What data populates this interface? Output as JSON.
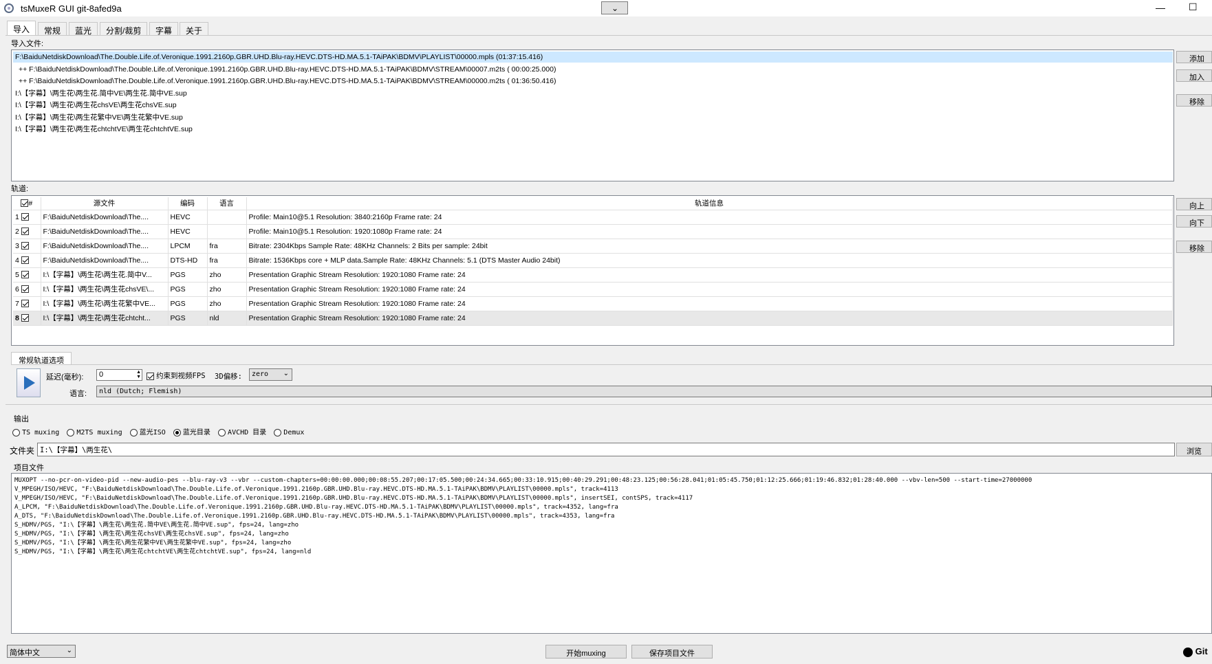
{
  "window": {
    "title": "tsMuxeR GUI git-8afed9a"
  },
  "tabs": [
    "导入",
    "常规",
    "蓝光",
    "分割/裁剪",
    "字幕",
    "关于"
  ],
  "input": {
    "label": "导入文件:",
    "files": [
      "F:\\BaiduNetdiskDownload\\The.Double.Life.of.Veronique.1991.2160p.GBR.UHD.Blu-ray.HEVC.DTS-HD.MA.5.1-TAiPAK\\BDMV\\PLAYLIST\\00000.mpls (01:37:15.416)",
      "++ F:\\BaiduNetdiskDownload\\The.Double.Life.of.Veronique.1991.2160p.GBR.UHD.Blu-ray.HEVC.DTS-HD.MA.5.1-TAiPAK\\BDMV\\STREAM\\00007.m2ts ( 00:00:25.000)",
      "++ F:\\BaiduNetdiskDownload\\The.Double.Life.of.Veronique.1991.2160p.GBR.UHD.Blu-ray.HEVC.DTS-HD.MA.5.1-TAiPAK\\BDMV\\STREAM\\00000.m2ts ( 01:36:50.416)",
      "I:\\【字幕】\\两生花\\两生花.简中VE\\两生花.简中VE.sup",
      "I:\\【字幕】\\两生花\\两生花chsVE\\两生花chsVE.sup",
      "I:\\【字幕】\\两生花\\两生花繁中VE\\两生花繁中VE.sup",
      "I:\\【字幕】\\两生花\\两生花chtchtVE\\两生花chtchtVE.sup"
    ],
    "buttons": {
      "add": "添加",
      "append": "加入",
      "remove": "移除"
    }
  },
  "tracks": {
    "label": "轨道:",
    "headers": [
      "#",
      "源文件",
      "编码",
      "语言",
      "轨道信息"
    ],
    "rows": [
      {
        "num": "1",
        "src": "F:\\BaiduNetdiskDownload\\The....",
        "codec": "HEVC",
        "lang": "",
        "info": "Profile: Main10@5.1 Resolution: 3840:2160p  Frame rate: 24"
      },
      {
        "num": "2",
        "src": "F:\\BaiduNetdiskDownload\\The....",
        "codec": "HEVC",
        "lang": "",
        "info": "Profile: Main10@5.1 Resolution: 1920:1080p  Frame rate: 24"
      },
      {
        "num": "3",
        "src": "F:\\BaiduNetdiskDownload\\The....",
        "codec": "LPCM",
        "lang": "fra",
        "info": "Bitrate: 2304Kbps  Sample Rate: 48KHz  Channels: 2  Bits per sample: 24bit"
      },
      {
        "num": "4",
        "src": "F:\\BaiduNetdiskDownload\\The....",
        "codec": "DTS-HD",
        "lang": "fra",
        "info": "Bitrate: 1536Kbps  core + MLP data.Sample Rate: 48KHz  Channels: 5.1 (DTS Master Audio 24bit)"
      },
      {
        "num": "5",
        "src": "I:\\【字幕】\\两生花\\两生花.简中V...",
        "codec": "PGS",
        "lang": "zho",
        "info": "Presentation Graphic Stream Resolution: 1920:1080 Frame rate: 24"
      },
      {
        "num": "6",
        "src": "I:\\【字幕】\\两生花\\两生花chsVE\\...",
        "codec": "PGS",
        "lang": "zho",
        "info": "Presentation Graphic Stream Resolution: 1920:1080 Frame rate: 24"
      },
      {
        "num": "7",
        "src": "I:\\【字幕】\\两生花\\两生花繁中VE...",
        "codec": "PGS",
        "lang": "zho",
        "info": "Presentation Graphic Stream Resolution: 1920:1080 Frame rate: 24"
      },
      {
        "num": "8",
        "src": "I:\\【字幕】\\两生花\\两生花chtcht...",
        "codec": "PGS",
        "lang": "nld",
        "info": "Presentation Graphic Stream Resolution: 1920:1080 Frame rate: 24"
      }
    ],
    "buttons": {
      "up": "向上",
      "down": "向下",
      "remove": "移除"
    }
  },
  "options": {
    "tab": "常规轨道选项",
    "delay_label": "延迟(毫秒):",
    "delay_value": "0",
    "fps_label": "约束到视频FPS",
    "shift_label": "3D偏移:",
    "shift_value": "zero",
    "lang_label": "语言:",
    "lang_value": "nld (Dutch; Flemish)"
  },
  "output": {
    "label": "输出",
    "modes": [
      "TS muxing",
      "M2TS muxing",
      "蓝光ISO",
      "蓝光目录",
      "AVCHD 目录",
      "Demux"
    ],
    "selected": "蓝光目录",
    "folder_label": "文件夹",
    "folder_value": "I:\\【字幕】\\两生花\\",
    "browse": "浏览"
  },
  "meta": {
    "label": "项目文件",
    "lines": [
      "MUXOPT --no-pcr-on-video-pid --new-audio-pes --blu-ray-v3 --vbr --custom-chapters=00:00:00.000;00:08:55.207;00:17:05.500;00:24:34.665;00:33:10.915;00:40:29.291;00:48:23.125;00:56:28.041;01:05:45.750;01:12:25.666;01:19:46.832;01:28:40.000 --vbv-len=500 --start-time=27000000",
      "V_MPEGH/ISO/HEVC, \"F:\\BaiduNetdiskDownload\\The.Double.Life.of.Veronique.1991.2160p.GBR.UHD.Blu-ray.HEVC.DTS-HD.MA.5.1-TAiPAK\\BDMV\\PLAYLIST\\00000.mpls\", track=4113",
      "V_MPEGH/ISO/HEVC, \"F:\\BaiduNetdiskDownload\\The.Double.Life.of.Veronique.1991.2160p.GBR.UHD.Blu-ray.HEVC.DTS-HD.MA.5.1-TAiPAK\\BDMV\\PLAYLIST\\00000.mpls\", insertSEI, contSPS, track=4117",
      "A_LPCM, \"F:\\BaiduNetdiskDownload\\The.Double.Life.of.Veronique.1991.2160p.GBR.UHD.Blu-ray.HEVC.DTS-HD.MA.5.1-TAiPAK\\BDMV\\PLAYLIST\\00000.mpls\", track=4352, lang=fra",
      "A_DTS, \"F:\\BaiduNetdiskDownload\\The.Double.Life.of.Veronique.1991.2160p.GBR.UHD.Blu-ray.HEVC.DTS-HD.MA.5.1-TAiPAK\\BDMV\\PLAYLIST\\00000.mpls\", track=4353, lang=fra",
      "S_HDMV/PGS, \"I:\\【字幕】\\两生花\\两生花.简中VE\\两生花.简中VE.sup\", fps=24, lang=zho",
      "S_HDMV/PGS, \"I:\\【字幕】\\两生花\\两生花chsVE\\两生花chsVE.sup\", fps=24, lang=zho",
      "S_HDMV/PGS, \"I:\\【字幕】\\两生花\\两生花繁中VE\\两生花繁中VE.sup\", fps=24, lang=zho",
      "S_HDMV/PGS, \"I:\\【字幕】\\两生花\\两生花chtchtVE\\两生花chtchtVE.sup\", fps=24, lang=nld"
    ]
  },
  "footer": {
    "language": "简体中文",
    "start": "开始muxing",
    "save": "保存项目文件",
    "git": "Git"
  }
}
